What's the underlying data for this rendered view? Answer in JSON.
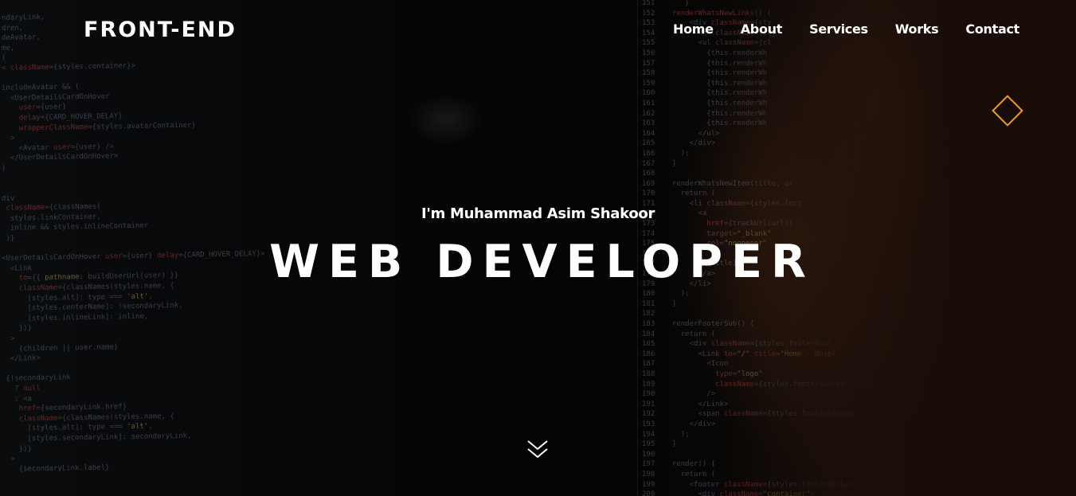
{
  "header": {
    "logo": "FRONT-END",
    "nav": [
      {
        "label": "Home"
      },
      {
        "label": "About"
      },
      {
        "label": "Services"
      },
      {
        "label": "Works"
      },
      {
        "label": "Contact"
      }
    ]
  },
  "hero": {
    "intro": "I'm Muhammad Asim Shakoor",
    "headline": "WEB DEVELOPER",
    "scroll_icon": "double-chevron-down-icon",
    "decoration_icon": "diamond-outline-icon"
  },
  "colors": {
    "accent": "#f39c1f",
    "text": "#ffffff",
    "background": "#050505"
  }
}
